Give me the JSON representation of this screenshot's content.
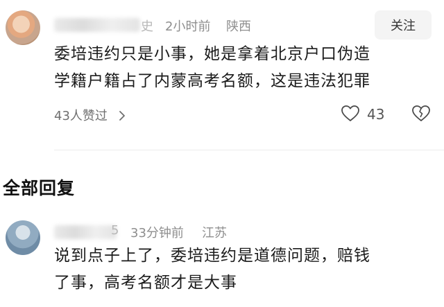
{
  "comment": {
    "username_suffix": "史",
    "time": "2小时前",
    "location": "陕西",
    "follow_label": "关注",
    "text_lines": [
      "委培违约只是小事，她是拿着北京户口伪造",
      "学籍户籍占了内蒙高考名额，这是违法犯罪"
    ],
    "likes_summary": "43人赞过",
    "like_count": "43",
    "icons": {
      "chevron": "chevron-right-icon",
      "like": "heart-outline-icon",
      "dislike": "broken-heart-icon"
    }
  },
  "replies_section": {
    "heading": "全部回复"
  },
  "reply": {
    "username_suffix": "5",
    "time": "33分钟前",
    "location": "江苏",
    "text_lines": [
      "说到点子上了，委培违约是道德问题，赔钱",
      "了事，高考名额才是大事"
    ]
  },
  "colors": {
    "meta_text": "#8e8e8e",
    "follow_bg": "#f4f4f4",
    "divider": "#ececec"
  }
}
